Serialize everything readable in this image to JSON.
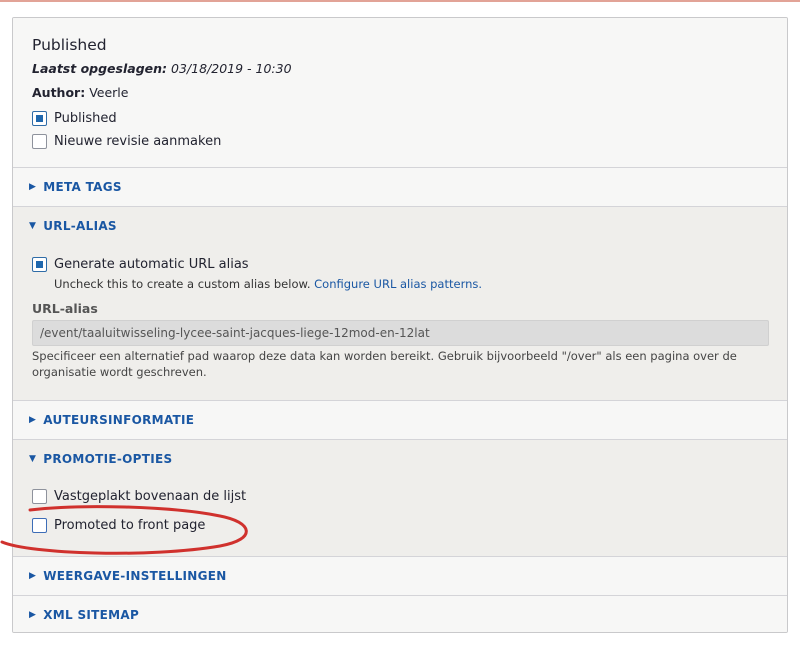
{
  "status": {
    "title": "Published",
    "last_saved_label": "Laatst opgeslagen:",
    "last_saved_value": "03/18/2019 - 10:30",
    "author_label": "Author:",
    "author_value": "Veerle",
    "published_label": "Published",
    "published_checked": true,
    "new_revision_label": "Nieuwe revisie aanmaken",
    "new_revision_checked": false
  },
  "sections": {
    "meta_tags": "META TAGS",
    "url_alias": "URL-ALIAS",
    "auteursinformatie": "AUTEURSINFORMATIE",
    "promotie_opties": "PROMOTIE-OPTIES",
    "weergave_instellingen": "WEERGAVE-INSTELLINGEN",
    "xml_sitemap": "XML SITEMAP"
  },
  "url_alias": {
    "auto_label": "Generate automatic URL alias",
    "auto_checked": true,
    "auto_desc": "Uncheck this to create a custom alias below.",
    "auto_link": "Configure URL alias patterns.",
    "field_label": "URL-alias",
    "field_value": "/event/taaluitwisseling-lycee-saint-jacques-liege-12mod-en-12lat",
    "help": "Specificeer een alternatief pad waarop deze data kan worden bereikt. Gebruik bijvoorbeeld \"/over\" als een pagina over de organisatie wordt geschreven."
  },
  "promotie": {
    "sticky_label": "Vastgeplakt bovenaan de lijst",
    "sticky_checked": false,
    "promoted_label": "Promoted to front page",
    "promoted_checked": false
  },
  "colors": {
    "link": "#1a57a3",
    "annotation": "#d0312d"
  }
}
